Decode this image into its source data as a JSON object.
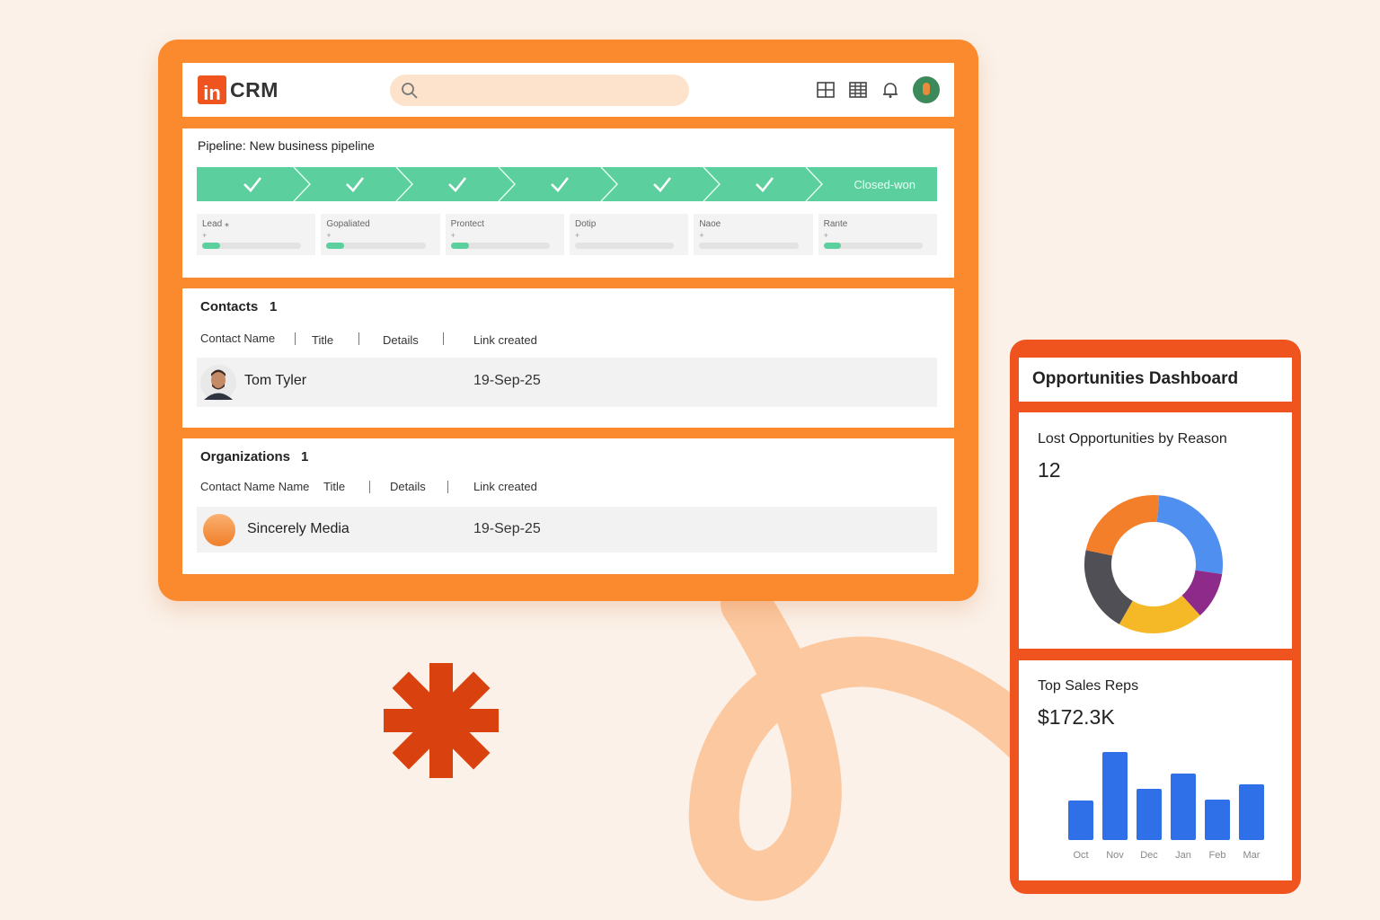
{
  "app": {
    "logo_badge": "in",
    "logo_text": "CRM",
    "search_placeholder": "",
    "icons": [
      "search-icon",
      "grid-icon",
      "table-icon",
      "bell-icon",
      "avatar"
    ]
  },
  "pipeline": {
    "title": "Pipeline: New business pipeline",
    "completed_stages": 6,
    "final_stage": "Closed-won",
    "stage_cards": [
      {
        "label": "Lead ⁎",
        "progress": 0.18
      },
      {
        "label": "Gopaliated",
        "progress": 0.18
      },
      {
        "label": "Prontect",
        "progress": 0.18
      },
      {
        "label": "Dotip",
        "progress": 0
      },
      {
        "label": "Naoe",
        "progress": 0
      },
      {
        "label": "Rante",
        "progress": 0.18
      }
    ],
    "plus": "+"
  },
  "contacts": {
    "title": "Contacts",
    "count": "1",
    "columns": [
      "Contact Name",
      "Title",
      "Details",
      "Link created"
    ],
    "rows": [
      {
        "name": "Tom Tyler",
        "date": "19-Sep-25"
      }
    ]
  },
  "organizations": {
    "title": "Organizations",
    "count": "1",
    "columns": [
      "Contact Name Name",
      "Title",
      "Details",
      "Link created"
    ],
    "rows": [
      {
        "name": "Sincerely Media",
        "date": "19-Sep-25"
      }
    ]
  },
  "dashboard": {
    "title": "Opportunities Dashboard",
    "lost": {
      "title": "Lost Opportunities by Reason",
      "value": "12"
    },
    "reps": {
      "title": "Top Sales Reps",
      "value": "$172.3K"
    }
  },
  "chart_data": [
    {
      "type": "pie",
      "title": "Lost Opportunities by Reason",
      "values": [
        26,
        11,
        20,
        20,
        23
      ],
      "colors": [
        "#4f8ff0",
        "#8e2a8a",
        "#f5b928",
        "#4f4f55",
        "#f47f2a"
      ]
    },
    {
      "type": "bar",
      "title": "Top Sales Reps",
      "categories": [
        "Oct",
        "Nov",
        "Dec",
        "Jan",
        "Feb",
        "Mar"
      ],
      "values": [
        44,
        98,
        57,
        74,
        45,
        62
      ],
      "colors": [
        "#2f6fe8"
      ]
    }
  ]
}
